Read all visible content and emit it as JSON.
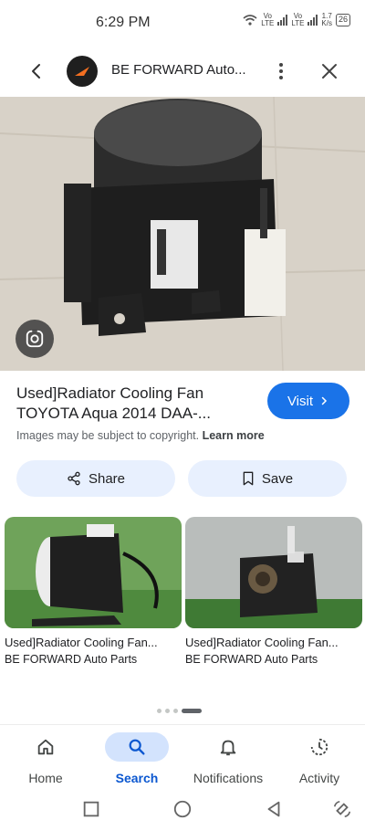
{
  "status_bar": {
    "time": "6:29 PM",
    "net1": "Vo\nLTE",
    "net2": "Vo\nLTE",
    "speed": "1.7\nK/s",
    "battery": "26"
  },
  "app_bar": {
    "site_title": "BE FORWARD Auto..."
  },
  "result": {
    "title": "Used]Radiator Cooling Fan TOYOTA Aqua 2014 DAA-...",
    "visit_label": "Visit",
    "copyright_text": "Images may be subject to copyright.",
    "learn_more": "Learn more"
  },
  "actions": {
    "share_label": "Share",
    "save_label": "Save"
  },
  "related": [
    {
      "title": "Used]Radiator Cooling Fan...",
      "source": "BE FORWARD Auto Parts"
    },
    {
      "title": "Used]Radiator Cooling Fan...",
      "source": "BE FORWARD Auto Parts"
    }
  ],
  "bottom_nav": {
    "home": "Home",
    "search": "Search",
    "notifications": "Notifications",
    "activity": "Activity"
  },
  "colors": {
    "accent": "#1a73e8",
    "pill_bg": "#e8f0fe",
    "active_nav_bg": "#d3e3fd"
  },
  "icons": [
    "back-arrow-icon",
    "more-vert-icon",
    "close-icon",
    "lens-icon",
    "chevron-right-icon",
    "share-icon",
    "bookmark-icon",
    "home-icon",
    "search-icon",
    "bell-icon",
    "activity-icon",
    "square-icon",
    "circle-icon",
    "triangle-icon",
    "rotate-icon"
  ]
}
